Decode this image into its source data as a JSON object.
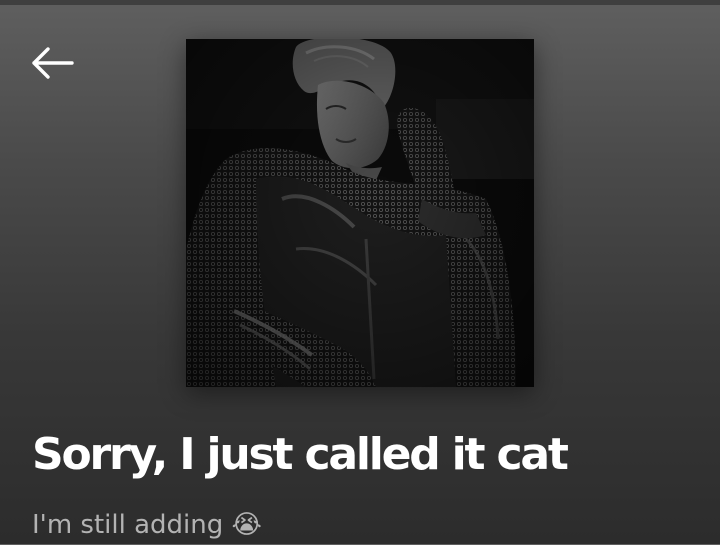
{
  "header": {
    "back_icon": "arrow-left-icon"
  },
  "playlist": {
    "cover_alt": "Playlist cover image",
    "title": "Sorry, I just called it cat",
    "description": "I'm still adding 😭"
  },
  "colors": {
    "title": "#ffffff",
    "description": "#b3b3b3",
    "background_top": "#5f5f5f",
    "background_bottom": "#2c2c2c"
  }
}
